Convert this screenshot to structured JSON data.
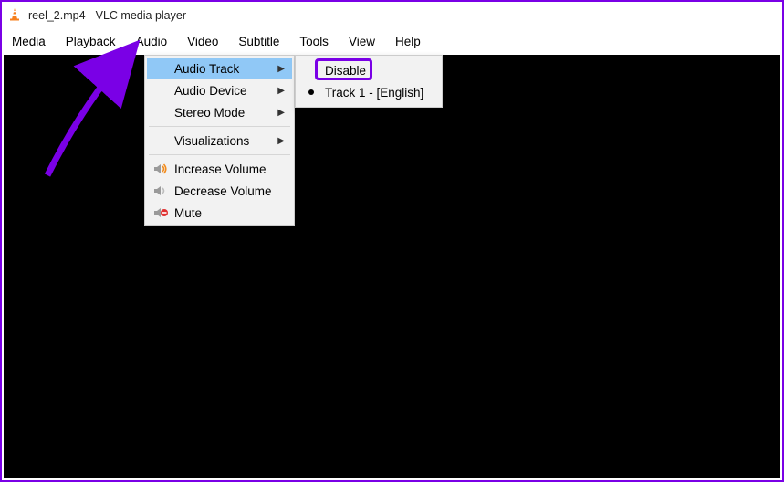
{
  "title": "reel_2.mp4 - VLC media player",
  "menubar": {
    "media": "Media",
    "playback": "Playback",
    "audio": "Audio",
    "video": "Video",
    "subtitle": "Subtitle",
    "tools": "Tools",
    "view": "View",
    "help": "Help"
  },
  "audio_menu": {
    "audio_track": "Audio Track",
    "audio_device": "Audio Device",
    "stereo_mode": "Stereo Mode",
    "visualizations": "Visualizations",
    "increase_volume": "Increase Volume",
    "decrease_volume": "Decrease Volume",
    "mute": "Mute"
  },
  "audio_track_submenu": {
    "disable": "Disable",
    "track1": "Track 1 - [English]"
  }
}
